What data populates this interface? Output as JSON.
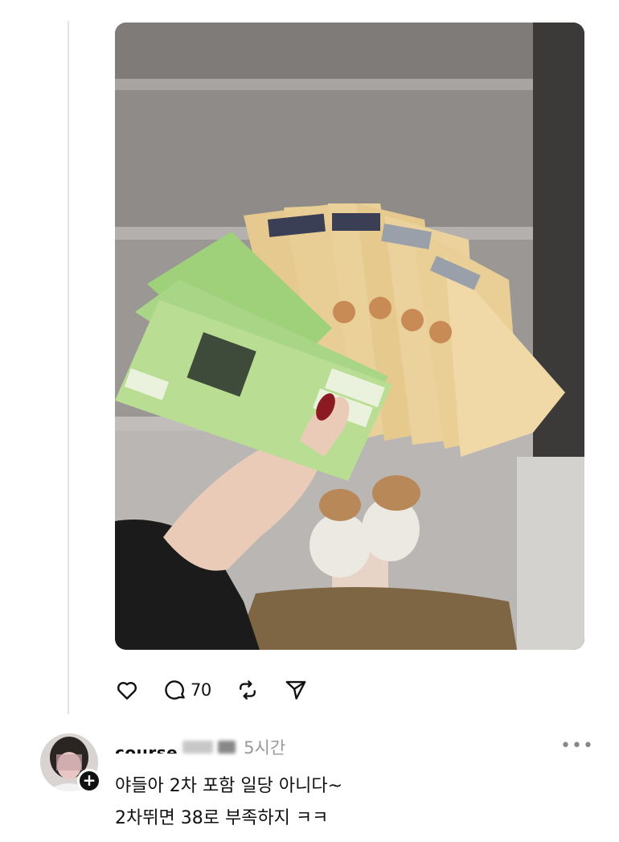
{
  "post": {
    "image_description_icon": "money-fan-photo",
    "actions": {
      "like_icon": "heart-icon",
      "comment_icon": "comment-bubble-icon",
      "comment_count": "70",
      "repost_icon": "repost-icon",
      "share_icon": "send-icon"
    }
  },
  "reply": {
    "username": "course",
    "time": "5시간",
    "more_icon": "more-dots-icon",
    "more_label": "•••",
    "add_label": "+",
    "text_line1": "야들아 2차 포함 일당 아니다~",
    "text_line2": "2차뛰면 38로 부족하지 ㅋㅋ"
  }
}
